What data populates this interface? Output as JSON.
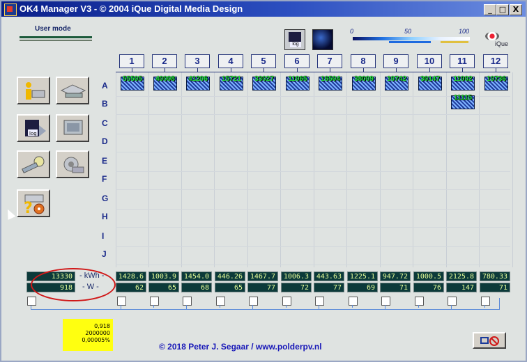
{
  "window": {
    "title": "OK4 Manager V3 - © 2004 iQue Digital Media Design"
  },
  "window_buttons": [
    "_",
    "□",
    "X"
  ],
  "user_mode": "User mode",
  "toolbar": {
    "log_label": "log"
  },
  "scale": {
    "labels": [
      "0",
      "50",
      "100"
    ]
  },
  "logo": {
    "text": "iQue"
  },
  "columns": [
    "1",
    "2",
    "3",
    "4",
    "5",
    "6",
    "7",
    "8",
    "9",
    "10",
    "11",
    "12"
  ],
  "rows": [
    "A",
    "B",
    "C",
    "D",
    "E",
    "F",
    "G",
    "H",
    "I",
    "J"
  ],
  "panels_row_a": [
    "55505",
    "40008",
    "41206",
    "15721",
    "33027",
    "11065",
    "16504",
    "38009",
    "10742",
    "30147",
    "11002",
    "10736"
  ],
  "panels_row_b": [
    {
      "col": 11,
      "label": "11115"
    }
  ],
  "totals": {
    "kwh": "13330",
    "w": "918",
    "kwh_unit": "- kWh -",
    "w_unit": "- W -"
  },
  "kwh_values": [
    "1428.6",
    "1003.9",
    "1454.0",
    "446.26",
    "1467.7",
    "1006.3",
    "443.63",
    "1225.1",
    "947.72",
    "1000.5",
    "2125.8",
    "780.33"
  ],
  "w_values": [
    "62",
    "65",
    "68",
    "65",
    "77",
    "72",
    "77",
    "69",
    "71",
    "76",
    "147",
    "71"
  ],
  "left_buttons": [
    "info",
    "network",
    "log",
    "display",
    "search",
    "settings",
    "help"
  ],
  "note": {
    "lines": [
      "0,918",
      "2000000",
      "0,00005%"
    ]
  },
  "credit": "© 2018 Peter J. Segaar / www.polderpv.nl",
  "colors": {
    "titlebar": "#0a1f8a",
    "accent": "#1a2a8a",
    "panel_label": "#21e33b",
    "ellipse": "#d01818"
  }
}
